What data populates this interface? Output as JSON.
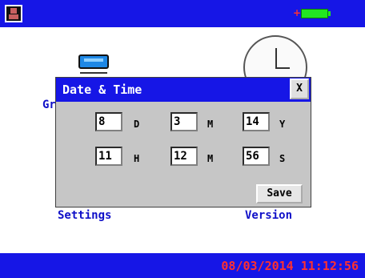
{
  "topbar": {
    "left_icon": "floppy-disk-icon",
    "charge_symbol": "+",
    "battery_icon": "battery-full-icon",
    "accent_color": "#1616e6",
    "battery_color": "#22e622",
    "charge_color": "#ff3030"
  },
  "background": {
    "label_left_top": "Gr",
    "label_settings": "Settings",
    "label_version": "Version",
    "icons": [
      "device-tube-icon",
      "clock-icon"
    ]
  },
  "dialog": {
    "title": "Date & Time",
    "close_label": "X",
    "fields": [
      {
        "value": "8",
        "unit": "D"
      },
      {
        "value": "3",
        "unit": "M"
      },
      {
        "value": "14",
        "unit": "Y"
      },
      {
        "value": "11",
        "unit": "H"
      },
      {
        "value": "12",
        "unit": "M"
      },
      {
        "value": "56",
        "unit": "S"
      }
    ],
    "save_label": "Save"
  },
  "statusbar": {
    "datetime": "08/03/2014 11:12:56",
    "datetime_color": "#ff3030"
  }
}
